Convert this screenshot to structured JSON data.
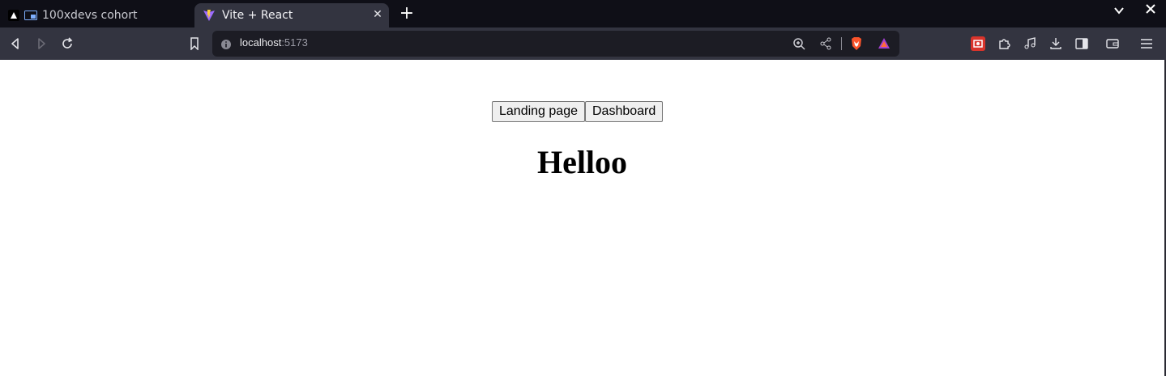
{
  "browser": {
    "tabs": [
      {
        "label": "100xdevs cohort",
        "active": false
      },
      {
        "label": "Vite + React",
        "active": true
      }
    ],
    "new_tab_label": "+",
    "url": {
      "host": "localhost",
      "port": ":5173"
    }
  },
  "page": {
    "buttons": {
      "landing": "Landing page",
      "dashboard": "Dashboard"
    },
    "heading": "Helloo"
  },
  "colors": {
    "chrome_bg": "#0f0f17",
    "toolbar_bg": "#333440",
    "brave_orange": "#fb542b"
  }
}
